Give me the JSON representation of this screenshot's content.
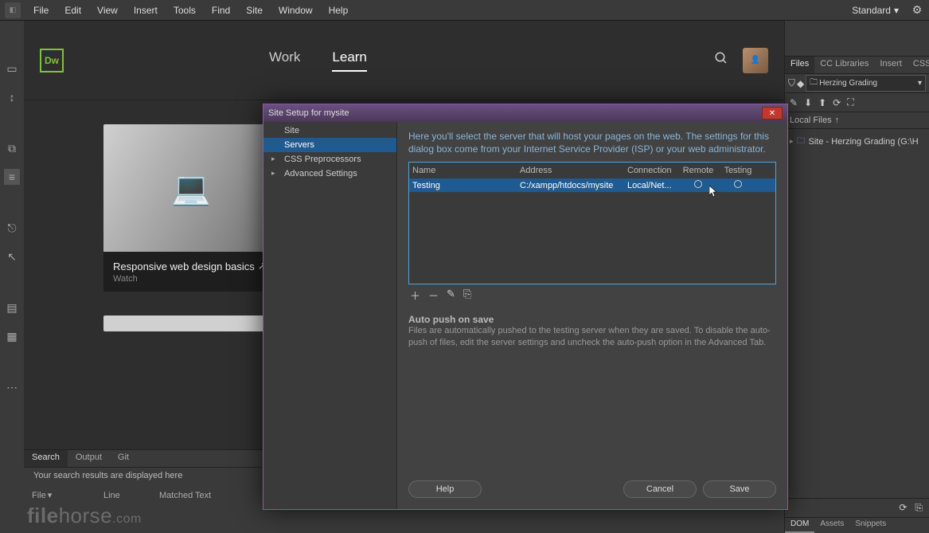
{
  "menubar": {
    "items": [
      "File",
      "Edit",
      "View",
      "Insert",
      "Tools",
      "Find",
      "Site",
      "Window",
      "Help"
    ],
    "workspace": "Standard"
  },
  "center": {
    "logo": "Dw",
    "tabs": {
      "work": "Work",
      "learn": "Learn"
    },
    "card": {
      "title": "Responsive web design basics",
      "sub": "Watch"
    }
  },
  "bottom": {
    "tabs": [
      "Search",
      "Output",
      "Git"
    ],
    "message": "Your search results are displayed here",
    "cols": [
      "File",
      "Line",
      "Matched Text"
    ]
  },
  "right": {
    "tabs": [
      "Files",
      "CC Libraries",
      "Insert",
      "CSS Des"
    ],
    "site_select": "Herzing Grading",
    "local_files": "Local Files",
    "tree_root": "Site - Herzing Grading (G:\\H",
    "bottom_tabs": [
      "DOM",
      "Assets",
      "Snippets"
    ]
  },
  "dialog": {
    "title": "Site Setup for mysite",
    "sidebar": [
      "Site",
      "Servers",
      "CSS Preprocessors",
      "Advanced Settings"
    ],
    "desc": "Here you'll select the server that will host your pages on the web. The settings for this dialog box come from your Internet Service Provider (ISP) or your web administrator.",
    "cols": {
      "name": "Name",
      "address": "Address",
      "connection": "Connection",
      "remote": "Remote",
      "testing": "Testing"
    },
    "row": {
      "name": "Testing",
      "address": "C:/xampp/htdocs/mysite",
      "connection": "Local/Net..."
    },
    "autopush": {
      "title": "Auto push on save",
      "desc": "Files are automatically pushed to the testing server when they are saved. To disable the auto-push of files, edit the server settings and uncheck the auto-push option in the Advanced Tab."
    },
    "buttons": {
      "help": "Help",
      "cancel": "Cancel",
      "save": "Save"
    }
  },
  "watermark": {
    "a": "file",
    "b": "horse",
    "c": ".com"
  }
}
